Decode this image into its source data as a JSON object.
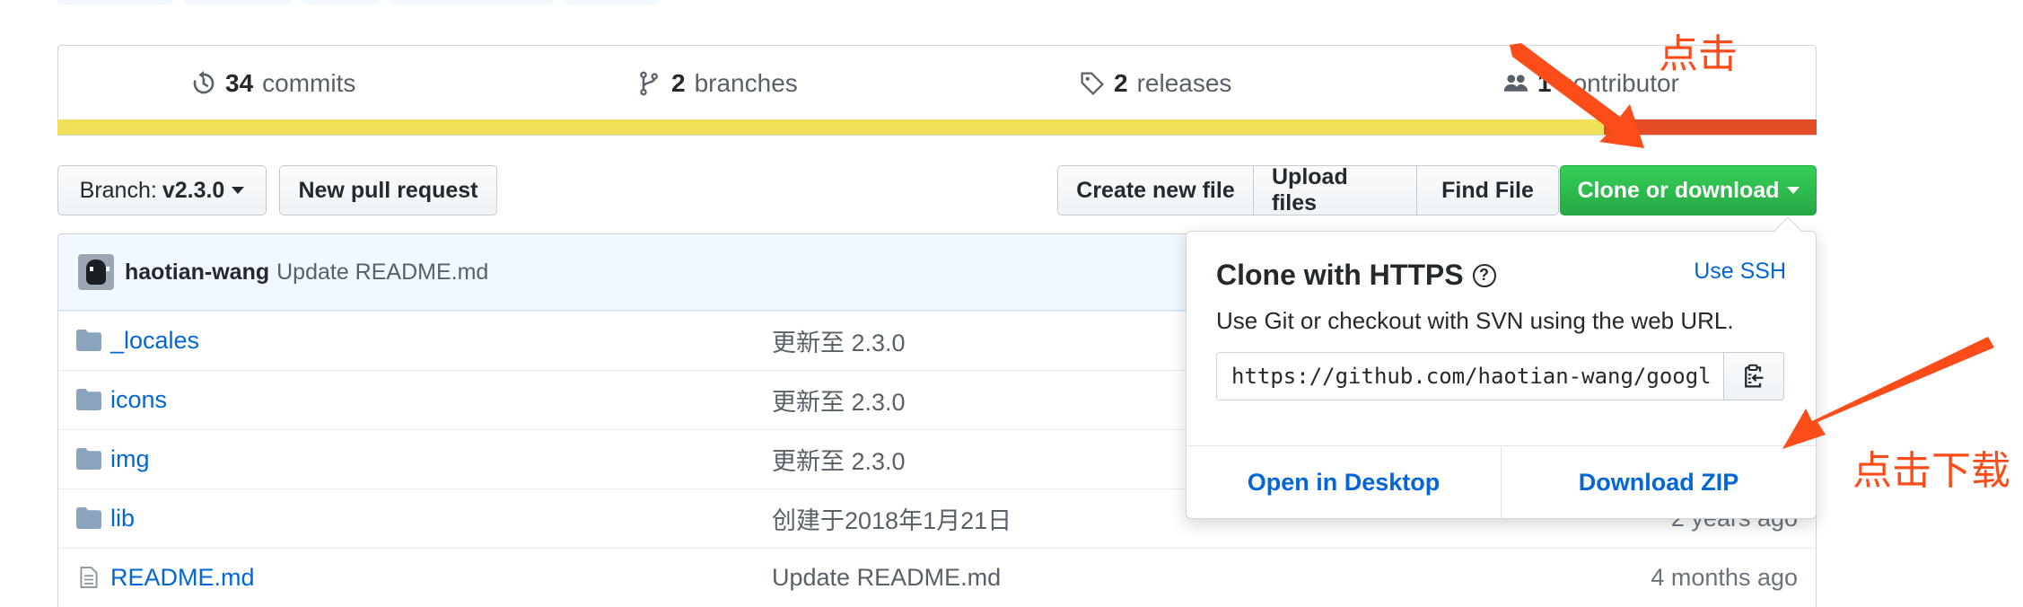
{
  "stats": {
    "commits": {
      "count": "34",
      "label": "commits",
      "icon": "history-icon"
    },
    "branches": {
      "count": "2",
      "label": "branches",
      "icon": "git-branch-icon"
    },
    "releases": {
      "count": "2",
      "label": "releases",
      "icon": "tag-icon"
    },
    "contributors": {
      "count": "1",
      "label": "contributor",
      "icon": "people-icon"
    }
  },
  "language_bar": {
    "colors": [
      "#f1e05a",
      "#e34c26"
    ]
  },
  "toolbar": {
    "branch_prefix": "Branch:",
    "branch_name": "v2.3.0",
    "new_pr": "New pull request",
    "create_file": "Create new file",
    "upload_files": "Upload files",
    "find_file": "Find File",
    "clone": "Clone or download"
  },
  "latest_commit": {
    "author": "haotian-wang",
    "message": "Update README.md"
  },
  "files": [
    {
      "name": "_locales",
      "type": "folder",
      "message": "更新至 2.3.0",
      "age": ""
    },
    {
      "name": "icons",
      "type": "folder",
      "message": "更新至 2.3.0",
      "age": ""
    },
    {
      "name": "img",
      "type": "folder",
      "message": "更新至 2.3.0",
      "age": ""
    },
    {
      "name": "lib",
      "type": "folder",
      "message": "创建于2018年1月21日",
      "age": "2 years ago"
    },
    {
      "name": "README.md",
      "type": "file",
      "message": "Update README.md",
      "age": "4 months ago"
    }
  ],
  "clone_popup": {
    "title": "Clone with HTTPS",
    "help": "?",
    "use_ssh": "Use SSH",
    "description": "Use Git or checkout with SVN using the web URL.",
    "url": "https://github.com/haotian-wang/googl",
    "open_desktop": "Open in Desktop",
    "download_zip": "Download ZIP"
  },
  "annotations": {
    "click": "点击",
    "click_download": "点击下载",
    "color": "#fc4c1a"
  },
  "colors": {
    "accent_link": "#0366d6",
    "clone_green": "#28a745"
  }
}
